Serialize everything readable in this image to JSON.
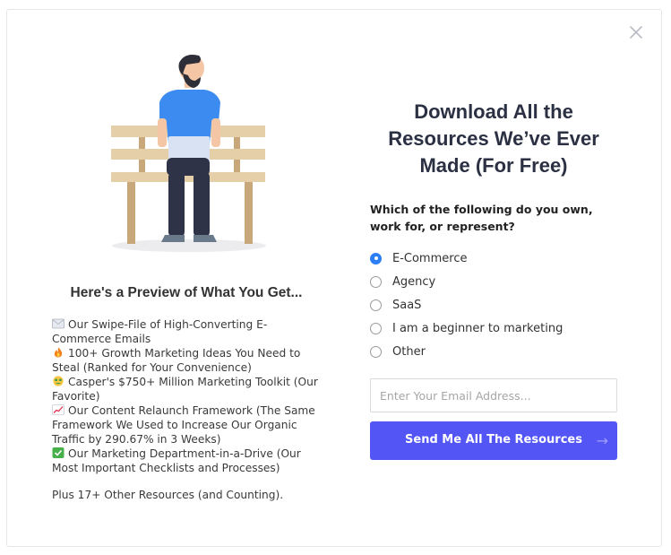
{
  "modal": {
    "close_icon": "close-icon",
    "illustration_icon": "man-on-bench-illustration"
  },
  "preview": {
    "title": "Here's a Preview of What You Get...",
    "items": [
      {
        "icon": "envelope-icon",
        "text": "Our Swipe-File of High-Converting E-Commerce Emails"
      },
      {
        "icon": "fire-icon",
        "text": "100+ Growth Marketing Ideas You Need to Steal (Ranked for Your Convenience)"
      },
      {
        "icon": "money-face-icon",
        "text": "Casper's $750+ Million Marketing Toolkit (Our Favorite)"
      },
      {
        "icon": "chart-increasing-icon",
        "text": "Our Content Relaunch Framework (The Same Framework We Used to Increase Our Organic Traffic by 290.67% in 3 Weeks)"
      },
      {
        "icon": "check-mark-icon",
        "text": "Our Marketing Department-in-a-Drive (Our Most Important Checklists and Processes)"
      }
    ],
    "footer": "Plus 17+ Other Resources (and Counting)."
  },
  "form": {
    "headline": "Download All the Resources We’ve Ever Made (For Free)",
    "question": "Which of the following do you own, work for, or represent?",
    "options": [
      {
        "label": "E-Commerce",
        "selected": true
      },
      {
        "label": "Agency",
        "selected": false
      },
      {
        "label": "SaaS",
        "selected": false
      },
      {
        "label": "I am a beginner to marketing",
        "selected": false
      },
      {
        "label": "Other",
        "selected": false
      }
    ],
    "email_placeholder": "Enter Your Email Address...",
    "email_value": "",
    "submit_label": "Send Me All The Resources",
    "submit_icon": "arrow-right-icon"
  },
  "colors": {
    "accent": "#5355f5",
    "radio_selected": "#2d7ef5",
    "headline": "#2b3043"
  }
}
